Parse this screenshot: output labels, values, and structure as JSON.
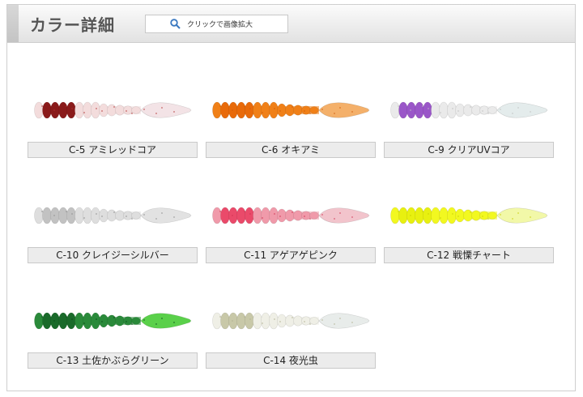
{
  "header": {
    "title": "カラー詳細",
    "zoom_label": "クリックで画像拡大"
  },
  "colors": [
    {
      "label": "C-5 アミレッドコア",
      "body": "#f3dcdc",
      "core": "#8a1a1a",
      "tail": "#f3e3e6",
      "fleck": "#b03030"
    },
    {
      "label": "C-6 オキアミ",
      "body": "#f08018",
      "core": "#e86a0a",
      "tail": "#f4b06a",
      "fleck": "#d05a08"
    },
    {
      "label": "C-9 クリアUVコア",
      "body": "#eaeaea",
      "core": "#9a56c8",
      "tail": "#e4ecec",
      "fleck": "#c0c0c0"
    },
    {
      "label": "C-10 クレイジーシルバー",
      "body": "#dedede",
      "core": "#c2c2c2",
      "tail": "#e2e2e2",
      "fleck": "#8a8a8a"
    },
    {
      "label": "C-11 アゲアゲピンク",
      "body": "#f09aaa",
      "core": "#ea4a6a",
      "tail": "#f2c4cc",
      "fleck": "#d03050"
    },
    {
      "label": "C-12 戦慄チャート",
      "body": "#f2f820",
      "core": "#e8f010",
      "tail": "#f2f8a8",
      "fleck": "#c8d000"
    },
    {
      "label": "C-13 土佐かぶらグリーン",
      "body": "#2a8a3a",
      "core": "#1a6a2a",
      "tail": "#5ad04a",
      "fleck": "#0a4a1a"
    },
    {
      "label": "C-14 夜光虫",
      "body": "#efefe6",
      "core": "#c8c8a8",
      "tail": "#e8ecea",
      "fleck": "#b0b090"
    }
  ]
}
